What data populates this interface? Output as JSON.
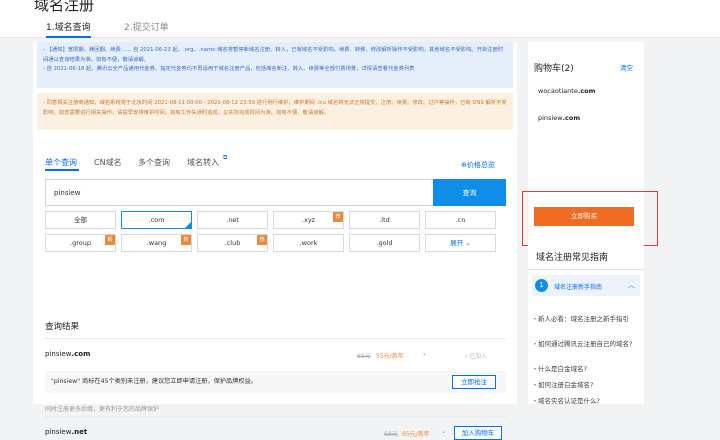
{
  "header": {
    "title": "域名注册",
    "tabs": [
      {
        "label": "1.域名查询"
      },
      {
        "label": "2.提交订单"
      }
    ]
  },
  "notices": {
    "blue_line1": "- 【通知】宽限期、赎回期、续费…… 自 2021-06-23 起，.org、.name 域名将暂停新域名注册、转入，已有域名不受影响，续费、转移、修改解析操作不受影响，其他域名不受影响。开启注册时间通以查询结果为准。如有不便，敬请谅解。",
    "blue_line2": "- 自 2021-06-18 起，腾讯云全产品通用代金券、指定代金券均不再适用于域名注册产品，包括域名新注、转入、续费等全部付费场景，详情请查看代金券列表",
    "orange_line": "- 同意相关注册商通知，域名系统将于北京时间 2021-08-11 00:00 - 2021-08-12 23:59 进行例行维护，维护期间 .icu 域名将无法正常提交，注册、续费、修改、过户等操作，已有 DNS 解析不受影响。如您需要进行相关操作，请提早安排维护时间。如有工作失误时造成，以实际完成时间为准。如有不便，敬请谅解。"
  },
  "search": {
    "tabs": [
      {
        "label": "单个查询"
      },
      {
        "label": "CN域名"
      },
      {
        "label": "多个查询"
      },
      {
        "label": "域名转入"
      }
    ],
    "transfer_icon": "external-link-icon",
    "price_link": "⊕价格总览",
    "input_value": "pinsiew",
    "button_label": "查询"
  },
  "suffixes": [
    {
      "label": "全部"
    },
    {
      "label": ".com"
    },
    {
      "label": ".net"
    },
    {
      "label": ".xyz",
      "badge": "荐"
    },
    {
      "label": ".ltd"
    },
    {
      "label": ".cn"
    },
    {
      "label": ".group",
      "badge": "新"
    },
    {
      "label": ".wang",
      "badge": "新"
    },
    {
      "label": ".club",
      "badge": "热"
    },
    {
      "label": ".work"
    },
    {
      "label": ".gold"
    },
    {
      "label": "展开 ⌄"
    }
  ],
  "results": {
    "title": "查询结果",
    "items": [
      {
        "prefix": "pinsiew",
        "suffix": ".com",
        "old_price": "65元",
        "new_price": "55元/首年",
        "chevron": "⌄",
        "status": "✓已加入"
      },
      {
        "prefix": "pinsiew",
        "suffix": ".net",
        "old_price": "68元",
        "new_price": "65元/首年",
        "chevron": "⌄",
        "status": "加入购物车"
      }
    ],
    "trademark_notice": "\"pinsiew\" 商标在45个类别未注册，建议您立即申请注册，保护品牌权益。",
    "trademark_button": "立即抢注",
    "protect_text": "同时注册更多后缀，更有利于您的品牌保护"
  },
  "cart": {
    "title": "购物车(2)",
    "clear": "清空",
    "items": [
      {
        "prefix": "wocaotiante",
        "suffix": ".com"
      },
      {
        "prefix": "pinsiew",
        "suffix": ".com"
      }
    ],
    "buy_button": "立即购买"
  },
  "guide": {
    "title": "域名注册常见指南",
    "section_number": "1",
    "section_label": "域名注册新手指南",
    "chevron": "︿",
    "items": [
      "新人必看：域名注册之新手指引",
      "如何通过腾讯云注册自己的域名?",
      "什么是白金域名?",
      "如何注册白金域名?",
      "域名实名认证是什么?"
    ]
  },
  "colors": {
    "accent": "#006eff",
    "buy": "#f06c22",
    "highlight_box": "#e53935"
  }
}
